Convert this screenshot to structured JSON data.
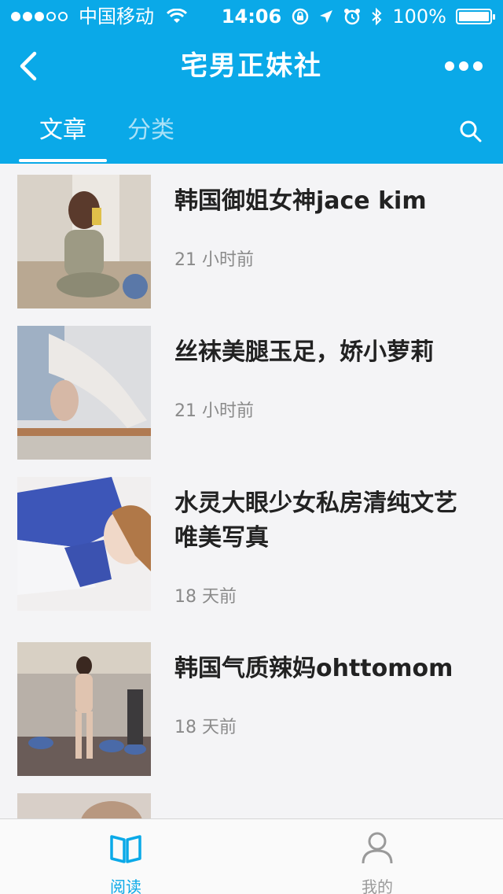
{
  "status_bar": {
    "carrier": "中国移动",
    "time": "14:06",
    "battery": "100%",
    "signal_strength": 3,
    "signal_max": 5
  },
  "nav": {
    "title": "宅男正妹社",
    "back_icon": "chevron-left-icon",
    "more_icon": "more-dots-icon"
  },
  "tabs": {
    "items": [
      {
        "label": "文章",
        "active": true
      },
      {
        "label": "分类",
        "active": false
      }
    ],
    "search_icon": "search-icon"
  },
  "articles": [
    {
      "title": "韩国御姐女神jace kim",
      "time": "21 小时前"
    },
    {
      "title": "丝袜美腿玉足，娇小萝莉",
      "time": "21 小时前"
    },
    {
      "title": "水灵大眼少女私房清纯文艺唯美写真",
      "time": "18 天前"
    },
    {
      "title": "韩国气质辣妈ohttomom",
      "time": "18 天前"
    }
  ],
  "tabbar": {
    "items": [
      {
        "label": "阅读",
        "icon": "book-icon",
        "active": true
      },
      {
        "label": "我的",
        "icon": "user-icon",
        "active": false
      }
    ]
  },
  "colors": {
    "brand": "#0aa9e8",
    "text": "#222222",
    "muted": "#8a8a8a"
  }
}
